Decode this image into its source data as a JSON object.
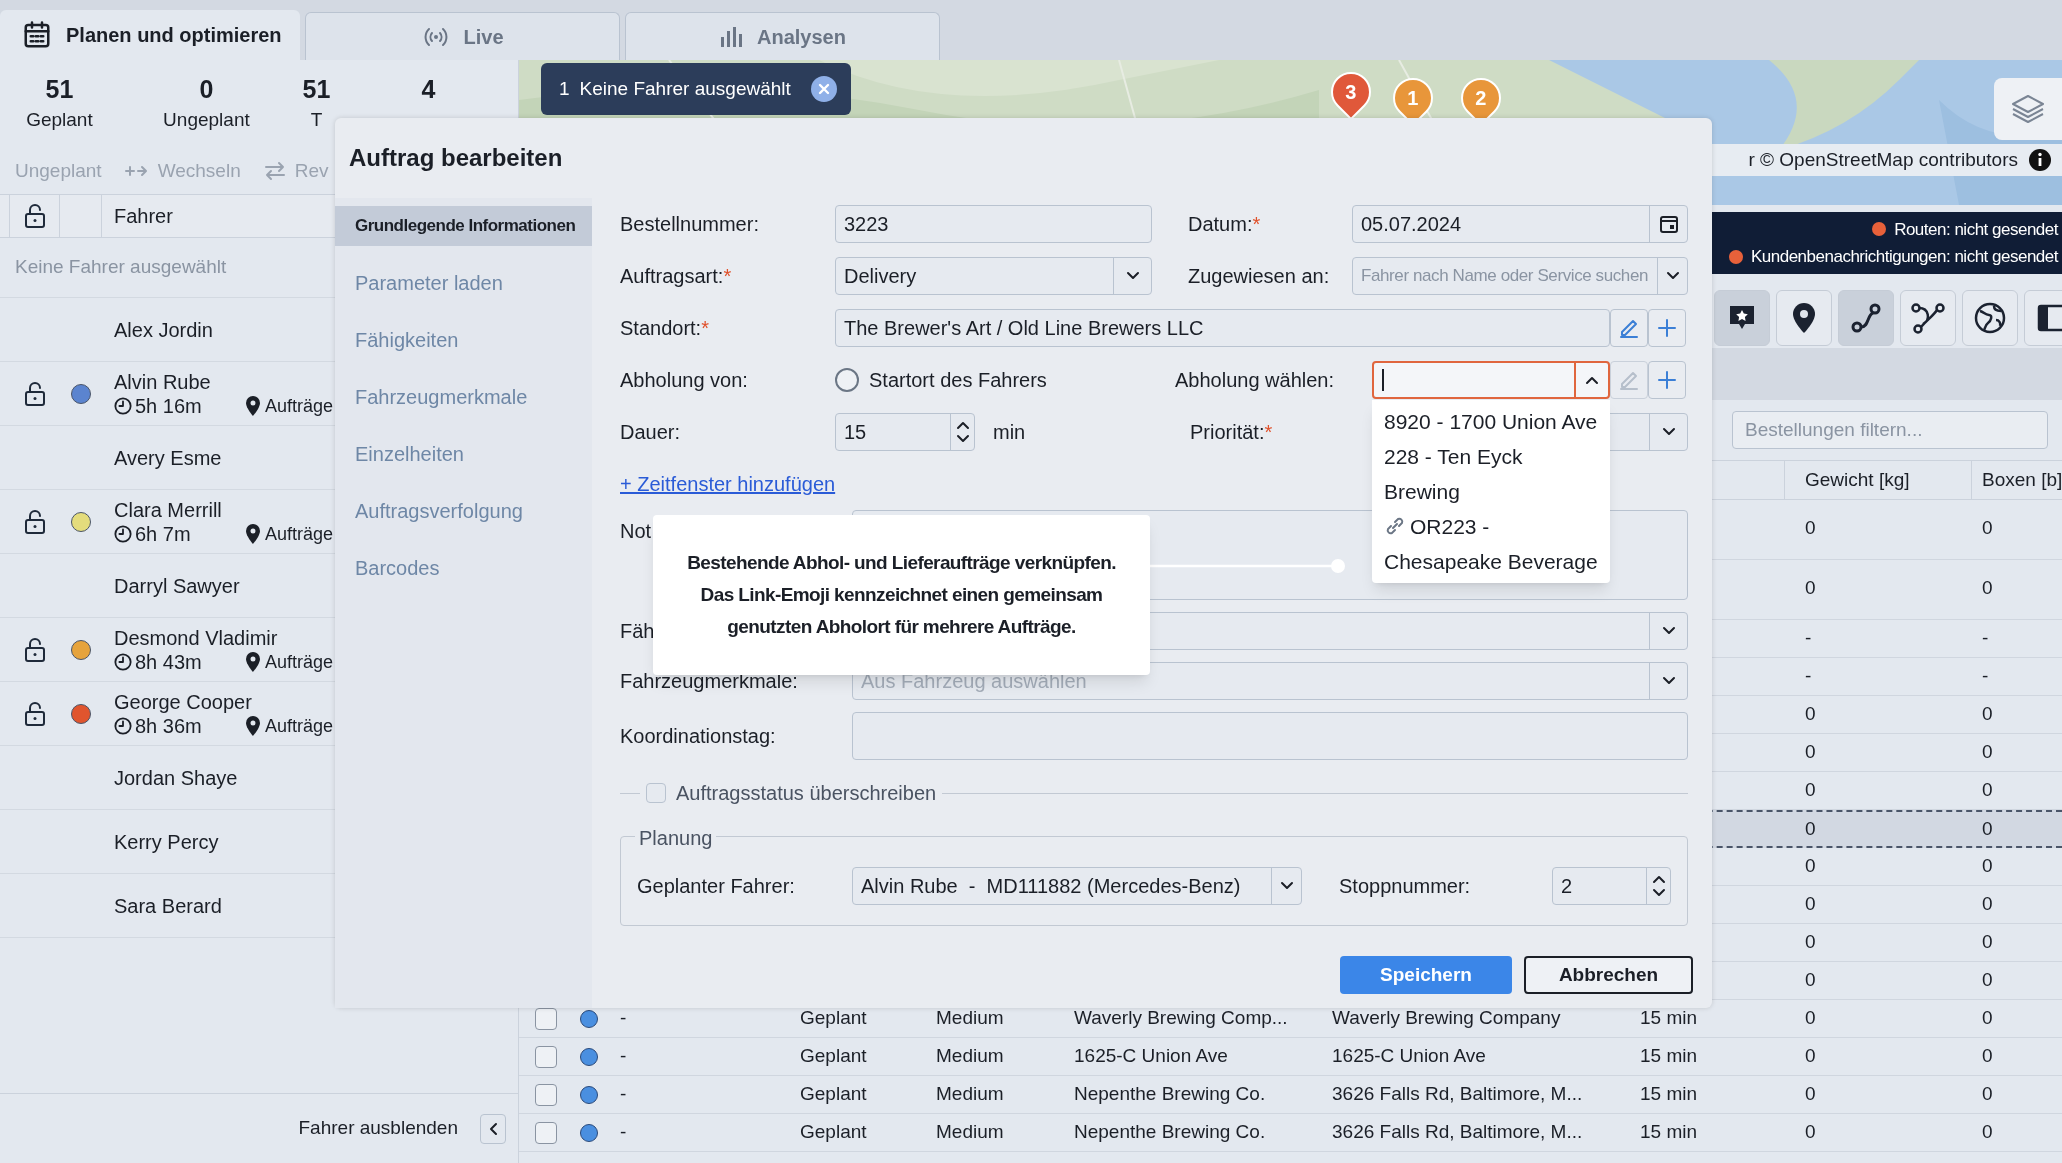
{
  "tabs": [
    {
      "label": "Planen und optimieren",
      "selected": true
    },
    {
      "label": "Live",
      "selected": false
    },
    {
      "label": "Analysen",
      "selected": false
    }
  ],
  "stats": [
    {
      "value": "51",
      "label": "Geplant"
    },
    {
      "value": "0",
      "label": "Ungeplant"
    },
    {
      "value": "51",
      "label": "T"
    },
    {
      "value": "4"
    }
  ],
  "toolbar": [
    {
      "label": "Ungeplant"
    },
    {
      "label": "Wechseln"
    },
    {
      "label": "Rev"
    }
  ],
  "drivers": {
    "column": "Fahrer",
    "empty_note": "Keine Fahrer ausgewählt",
    "rows": [
      {
        "name": "Alex Jordin"
      },
      {
        "name": "Alvin Rube",
        "locked": false,
        "color": "#5b84cf",
        "duration": "5h 16m",
        "orders": "Aufträge"
      },
      {
        "name": "Avery Esme"
      },
      {
        "name": "Clara Merrill",
        "locked": false,
        "color": "#e4dc7c",
        "duration": "6h 7m",
        "orders": "Aufträge"
      },
      {
        "name": "Darryl Sawyer"
      },
      {
        "name": "Desmond Vladimir",
        "locked": false,
        "color": "#e6a33c",
        "duration": "8h 43m",
        "orders": "Aufträge"
      },
      {
        "name": "George Cooper",
        "locked": false,
        "color": "#e0552e",
        "duration": "8h 36m",
        "orders": "Aufträge"
      },
      {
        "name": "Jordan Shaye"
      },
      {
        "name": "Kerry Percy"
      },
      {
        "name": "Sara Berard"
      }
    ],
    "hide_label": "Fahrer ausblenden"
  },
  "map": {
    "chip": {
      "count": "1",
      "label": "Keine Fahrer ausgewählt"
    },
    "markers": [
      {
        "label": "3",
        "color": "#e0583a"
      },
      {
        "label": "1",
        "color": "#e8963a"
      },
      {
        "label": "2",
        "color": "#e8963a"
      }
    ],
    "attribution": "r © OpenStreetMap contributors"
  },
  "status": [
    {
      "label": "Routen: nicht gesendet",
      "sent": false
    },
    {
      "label": "Kundenbenachrichtigungen: nicht gesendet",
      "sent": false
    }
  ],
  "orders": {
    "filter_placeholder": "Bestellungen filtern...",
    "columns": [
      "Gewicht [kg]",
      "Boxen [b]"
    ],
    "rows": [
      {
        "kind": "covered",
        "selected": false,
        "weight": "0",
        "boxes": "0"
      },
      {
        "kind": "covered",
        "selected": false,
        "weight": "0",
        "boxes": "0"
      },
      {
        "kind": "covered",
        "selected": false,
        "weight": "-",
        "boxes": "-"
      },
      {
        "kind": "covered",
        "selected": false,
        "weight": "-",
        "boxes": "-"
      },
      {
        "kind": "covered",
        "selected": false,
        "weight": "0",
        "boxes": "0"
      },
      {
        "kind": "covered",
        "selected": false,
        "weight": "0",
        "boxes": "0"
      },
      {
        "kind": "covered",
        "selected": false,
        "weight": "0",
        "boxes": "0"
      },
      {
        "kind": "covered",
        "selected": true,
        "weight": "0",
        "boxes": "0"
      },
      {
        "kind": "covered",
        "selected": false,
        "weight": "0",
        "boxes": "0"
      },
      {
        "kind": "covered",
        "selected": false,
        "weight": "0",
        "boxes": "0"
      },
      {
        "kind": "covered",
        "selected": false,
        "weight": "0",
        "boxes": "0"
      },
      {
        "kind": "covered",
        "selected": false,
        "weight": "0",
        "boxes": "0"
      },
      {
        "kind": "full",
        "selected": false,
        "checked": false,
        "color": "#4a8fe0",
        "ref": "-",
        "status": "Geplant",
        "priority": "Medium",
        "name": "Waverly Brewing Comp...",
        "address": "Waverly Brewing Company",
        "duration": "15 min",
        "weight": "0",
        "boxes": "0"
      },
      {
        "kind": "full",
        "selected": false,
        "checked": false,
        "color": "#4a8fe0",
        "ref": "-",
        "status": "Geplant",
        "priority": "Medium",
        "name": "1625-C Union Ave",
        "address": "1625-C Union Ave",
        "duration": "15 min",
        "weight": "0",
        "boxes": "0"
      },
      {
        "kind": "full",
        "selected": false,
        "checked": false,
        "color": "#4a8fe0",
        "ref": "-",
        "status": "Geplant",
        "priority": "Medium",
        "name": "Nepenthe Brewing Co.",
        "address": "3626 Falls Rd, Baltimore, M...",
        "duration": "15 min",
        "weight": "0",
        "boxes": "0"
      },
      {
        "kind": "full",
        "selected": false,
        "checked": false,
        "color": "#4a8fe0",
        "ref": "-",
        "status": "Geplant",
        "priority": "Medium",
        "name": "Nepenthe Brewing Co.",
        "address": "3626 Falls Rd, Baltimore, M...",
        "duration": "15 min",
        "weight": "0",
        "boxes": "0"
      }
    ]
  },
  "dialog": {
    "title": "Auftrag bearbeiten",
    "nav": [
      {
        "label": "Grundlegende Informationen",
        "selected": true
      },
      {
        "label": "Parameter laden",
        "selected": false
      },
      {
        "label": "Fähigkeiten",
        "selected": false
      },
      {
        "label": "Fahrzeugmerkmale",
        "selected": false
      },
      {
        "label": "Einzelheiten",
        "selected": false
      },
      {
        "label": "Auftragsverfolgung",
        "selected": false
      },
      {
        "label": "Barcodes",
        "selected": false
      }
    ],
    "order_number": {
      "label": "Bestellnummer:",
      "value": "3223"
    },
    "date": {
      "label": "Datum:",
      "required_mark": "*",
      "value": "05.07.2024"
    },
    "order_type": {
      "label": "Auftragsart:",
      "required_mark": "*",
      "value": "Delivery"
    },
    "assigned_to": {
      "label": "Zugewiesen an:",
      "placeholder": "Fahrer nach Name oder Service suchen"
    },
    "location": {
      "label": "Standort:",
      "required_mark": "*",
      "value": "The Brewer's Art / Old Line Brewers LLC"
    },
    "pickup_from": {
      "label": "Abholung von:",
      "option": "Startort des Fahrers",
      "selected": false
    },
    "pickup_select": {
      "label": "Abholung wählen:",
      "expanded": true,
      "options": [
        {
          "label": "8920 - 1700 Union Ave",
          "linked": false
        },
        {
          "label": "228 - Ten Eyck Brewing",
          "linked": false
        },
        {
          "label": "OR223 - Chesapeake Beverage",
          "linked": true
        }
      ]
    },
    "duration": {
      "label": "Dauer:",
      "value": "15",
      "unit": "min"
    },
    "priority": {
      "label": "Priorität:",
      "required_mark": "*"
    },
    "time_window_link": "+ Zeitfenster hinzufügen",
    "notes": {
      "label": "Not"
    },
    "capabilities": {
      "label": "Fäh"
    },
    "vehicle_features": {
      "label": "Fahrzeugmerkmale:",
      "placeholder": "Aus Fahrzeug auswählen"
    },
    "coordination_day": {
      "label": "Koordinationstag:"
    },
    "override_status": {
      "label": "Auftragsstatus überschreiben",
      "checked": false
    },
    "planning": {
      "legend": "Planung",
      "driver_label": "Geplanter Fahrer:",
      "driver": "Alvin Rube  -  MD111882 (Mercedes-Benz)",
      "stop_label": "Stoppnummer:",
      "stop": "2"
    },
    "tooltip": [
      "Bestehende Abhol- und Lieferaufträge verknüpfen.",
      "Das Link-Emoji kennzeichnet einen gemeinsam",
      "genutzten Abholort für mehrere Aufträge."
    ],
    "buttons": [
      {
        "label": "Speichern",
        "kind": "primary"
      },
      {
        "label": "Abbrechen",
        "kind": "secondary"
      }
    ]
  }
}
